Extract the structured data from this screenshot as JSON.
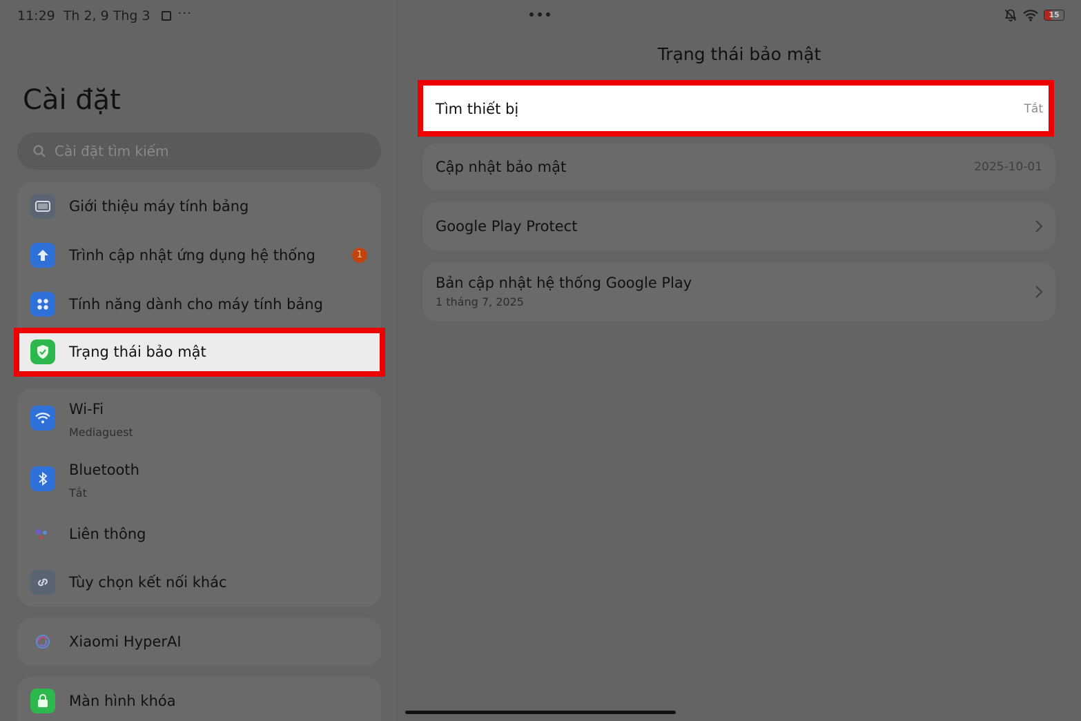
{
  "status_bar": {
    "time": "11:29",
    "date": "Th 2, 9 Thg 3",
    "more": "···",
    "battery": "15"
  },
  "settings": {
    "title": "Cài đặt",
    "search_placeholder": "Cài đặt tìm kiếm",
    "items": [
      {
        "label": "Giới thiệu máy tính bảng",
        "icon": "tablet-icon"
      },
      {
        "label": "Trình cập nhật ứng dụng hệ thống",
        "icon": "update-arrow-icon",
        "badge": "1"
      },
      {
        "label": "Tính năng dành cho máy tính bảng",
        "icon": "grid-icon"
      },
      {
        "label": "Trạng thái bảo mật",
        "icon": "shield-check-icon"
      },
      {
        "label": "Wi-Fi",
        "sub": "Mediaguest",
        "icon": "wifi-icon"
      },
      {
        "label": "Bluetooth",
        "sub": "Tắt",
        "icon": "bluetooth-icon"
      },
      {
        "label": "Liên thông",
        "icon": "interconnect-icon"
      },
      {
        "label": "Tùy chọn kết nối khác",
        "icon": "link-icon"
      },
      {
        "label": "Xiaomi HyperAI",
        "icon": "hyperai-icon"
      },
      {
        "label": "Màn hình khóa",
        "icon": "lock-icon"
      }
    ]
  },
  "detail": {
    "title": "Trạng thái bảo mật",
    "rows": [
      {
        "label": "Tìm thiết bị",
        "value": "Tắt"
      },
      {
        "label": "Cập nhật bảo mật",
        "value": "2025-10-01"
      },
      {
        "label": "Google Play Protect"
      },
      {
        "label": "Bản cập nhật hệ thống Google Play",
        "sub": "1 tháng 7, 2025"
      }
    ]
  },
  "colors": {
    "highlight": "#ee0000",
    "background_dim": "#646464",
    "blue_icon": "#2f6fd8",
    "green_icon": "#2db84d"
  }
}
